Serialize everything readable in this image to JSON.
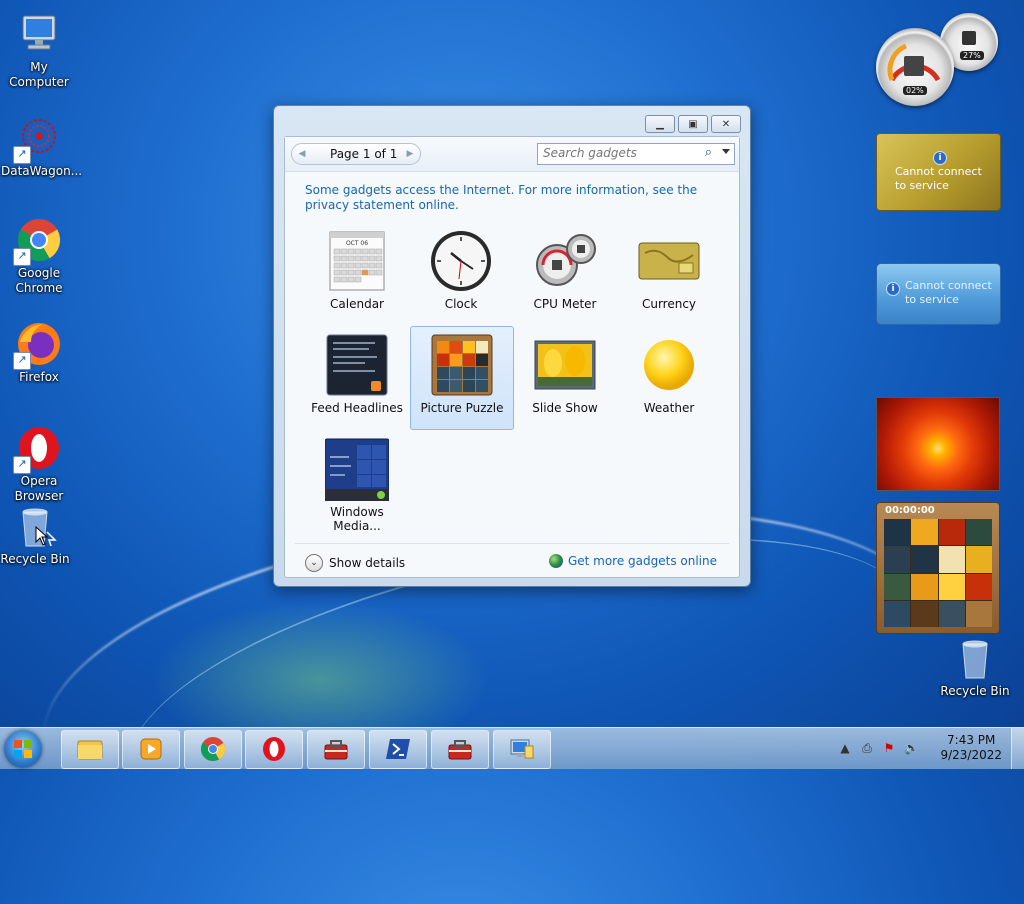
{
  "desktop": {
    "icons": [
      {
        "label": "My Computer"
      },
      {
        "label": "DataWagon..."
      },
      {
        "label": "Google Chrome"
      },
      {
        "label": "Firefox"
      },
      {
        "label": "Opera Browser"
      },
      {
        "label": "Recycle Bin"
      }
    ],
    "recycle_bin_right": "Recycle Bin"
  },
  "gadget_dialog": {
    "pager": "Page 1 of 1",
    "search_placeholder": "Search gadgets",
    "notice": "Some gadgets access the Internet.  For more information, see the privacy statement online.",
    "gadgets": [
      {
        "name": "Calendar"
      },
      {
        "name": "Clock"
      },
      {
        "name": "CPU Meter"
      },
      {
        "name": "Currency"
      },
      {
        "name": "Feed Headlines"
      },
      {
        "name": "Picture Puzzle",
        "selected": true
      },
      {
        "name": "Slide Show"
      },
      {
        "name": "Weather"
      },
      {
        "name": "Windows Media..."
      }
    ],
    "calendar_month": "OCT 06",
    "show_details": "Show details",
    "get_more": "Get more gadgets online"
  },
  "sidebar_gadgets": {
    "cpu_percent": "02%",
    "memory_percent": "27%",
    "currency_status": "Cannot connect to service",
    "weather_status": "Cannot connect to service",
    "puzzle_timer": "00:00:00"
  },
  "taskbar": {
    "time": "7:43 PM",
    "date": "9/23/2022"
  },
  "colors": {
    "accent": "#1766b5",
    "selection": "#cfe3fa"
  }
}
